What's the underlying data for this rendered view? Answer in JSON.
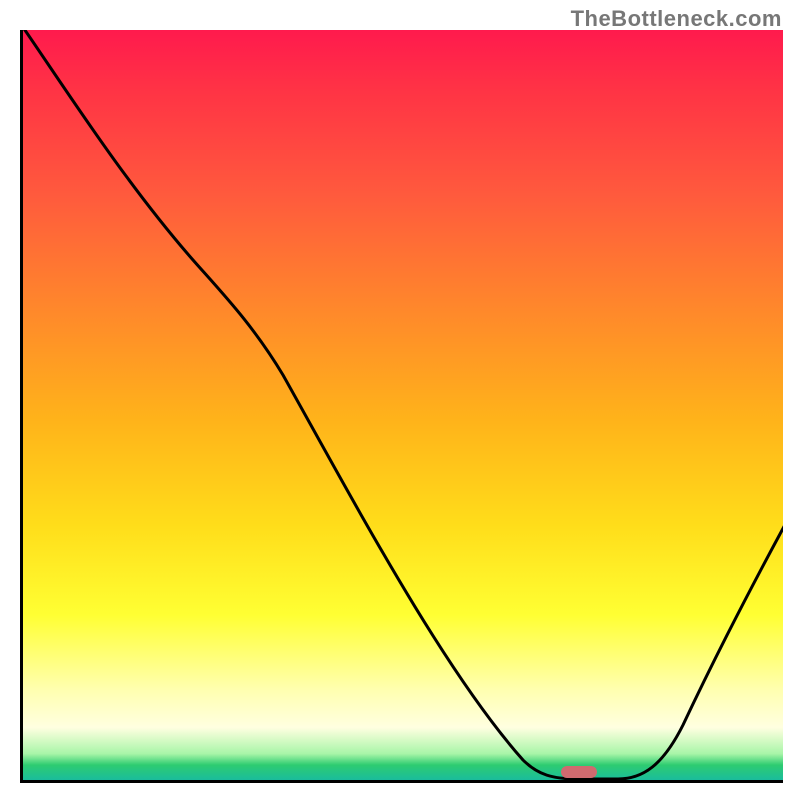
{
  "watermark": "TheBottleneck.com",
  "chart_data": {
    "type": "line",
    "title": "",
    "xlabel": "",
    "ylabel": "",
    "xlim": [
      0,
      100
    ],
    "ylim": [
      0,
      100
    ],
    "grid": false,
    "background_gradient": {
      "direction": "vertical",
      "stops": [
        {
          "pos": 0,
          "color": "#ff1a4d"
        },
        {
          "pos": 22,
          "color": "#ff5a3d"
        },
        {
          "pos": 52,
          "color": "#ffb31a"
        },
        {
          "pos": 78,
          "color": "#ffff33"
        },
        {
          "pos": 93,
          "color": "#ffffe0"
        },
        {
          "pos": 98,
          "color": "#2ecc71"
        },
        {
          "pos": 100,
          "color": "#1abc9c"
        }
      ]
    },
    "series": [
      {
        "name": "bottleneck-curve",
        "x": [
          0,
          5,
          12,
          22,
          30,
          40,
          50,
          60,
          66,
          72,
          78,
          80,
          84,
          90,
          95,
          100
        ],
        "y": [
          100,
          94,
          85,
          70,
          62,
          50,
          37,
          20,
          8,
          2,
          0,
          0,
          4,
          15,
          25,
          38
        ],
        "color": "#000000"
      }
    ],
    "markers": [
      {
        "name": "optimal-point",
        "x": 75,
        "y": 0,
        "color": "#d06a6f",
        "shape": "pill"
      }
    ],
    "notes": "x-axis and y-axis have no visible tick labels; values are normalized 0-100 estimates. Curve descends from top-left (~100) to a minimum near x≈75 (y≈0) then rises toward x=100 (y≈38). Background gradient encodes severity (red=high mismatch, green=balanced)."
  }
}
